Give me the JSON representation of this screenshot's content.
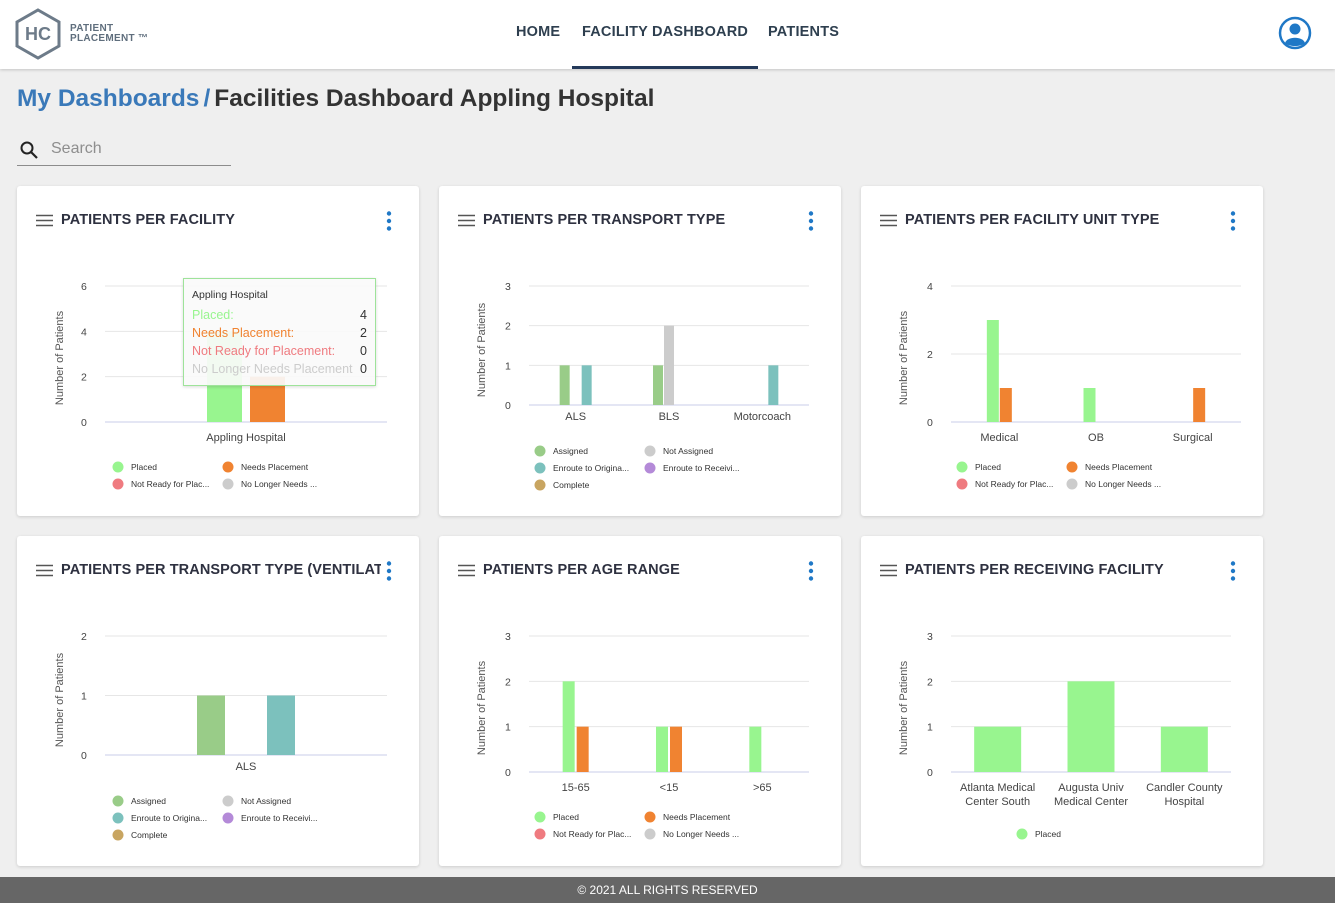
{
  "app": {
    "logo_letters": "HC",
    "logo_line1": "PATIENT",
    "logo_line2": "PLACEMENT ™"
  },
  "nav": {
    "home": "HOME",
    "facility_dashboard": "FACILITY DASHBOARD",
    "patients": "PATIENTS",
    "active": "FACILITY DASHBOARD"
  },
  "breadcrumb": {
    "parent": "My Dashboards",
    "separator": "/",
    "current": "Facilities Dashboard Appling Hospital"
  },
  "search": {
    "placeholder": "Search",
    "value": ""
  },
  "colors": {
    "placed": "#98f58f",
    "needs_placement": "#f08331",
    "not_ready": "#ef7b80",
    "no_longer": "#cccccc",
    "assigned": "#99cc88",
    "not_assigned": "#cccccc",
    "enroute_orig": "#7cc1bd",
    "enroute_recv": "#b48ad8",
    "complete": "#c8a561",
    "brand": "#3a79b9"
  },
  "cards": [
    {
      "title": "PATIENTS PER FACILITY"
    },
    {
      "title": "PATIENTS PER TRANSPORT TYPE"
    },
    {
      "title": "PATIENTS PER FACILITY UNIT TYPE"
    },
    {
      "title": "PATIENTS PER TRANSPORT TYPE (VENTILATOR)"
    },
    {
      "title": "PATIENTS PER AGE RANGE"
    },
    {
      "title": "PATIENTS PER RECEIVING FACILITY"
    }
  ],
  "tooltip": {
    "title": "Appling Hospital",
    "rows": [
      {
        "label": "Placed:",
        "value": "4",
        "color": "#98f58f"
      },
      {
        "label": "Needs Placement:",
        "value": "2",
        "color": "#f08331"
      },
      {
        "label": "Not Ready for Placement:",
        "value": "0",
        "color": "#ef7b80"
      },
      {
        "label": "No Longer Needs Placement",
        "value": "0",
        "color": "#cccccc"
      }
    ]
  },
  "chart_data": [
    {
      "type": "bar",
      "ylabel": "Number of Patients",
      "ylim": [
        0,
        6
      ],
      "yticks": [
        0,
        2,
        4,
        6
      ],
      "categories": [
        "Appling Hospital"
      ],
      "series": [
        {
          "name": "Placed",
          "color": "#98f58f",
          "values": [
            4
          ]
        },
        {
          "name": "Needs Placement",
          "color": "#f08331",
          "values": [
            2
          ]
        },
        {
          "name": "Not Ready for Plac...",
          "color": "#ef7b80",
          "values": [
            0
          ]
        },
        {
          "name": "No Longer Needs ...",
          "color": "#cccccc",
          "values": [
            0
          ]
        }
      ]
    },
    {
      "type": "bar",
      "ylabel": "Number of Patients",
      "ylim": [
        0,
        3
      ],
      "yticks": [
        0,
        1,
        2,
        3
      ],
      "categories": [
        "ALS",
        "BLS",
        "Motorcoach"
      ],
      "series": [
        {
          "name": "Assigned",
          "color": "#99cc88",
          "values": [
            1,
            1,
            0
          ]
        },
        {
          "name": "Not Assigned",
          "color": "#cccccc",
          "values": [
            0,
            2,
            0
          ]
        },
        {
          "name": "Enroute to Origina...",
          "color": "#7cc1bd",
          "values": [
            1,
            0,
            1
          ]
        },
        {
          "name": "Enroute to Receivi...",
          "color": "#b48ad8",
          "values": [
            0,
            0,
            0
          ]
        },
        {
          "name": "Complete",
          "color": "#c8a561",
          "values": [
            0,
            0,
            0
          ]
        }
      ]
    },
    {
      "type": "bar",
      "ylabel": "Number of Patients",
      "ylim": [
        0,
        4
      ],
      "yticks": [
        0,
        2,
        4
      ],
      "categories": [
        "Medical",
        "OB",
        "Surgical"
      ],
      "series": [
        {
          "name": "Placed",
          "color": "#98f58f",
          "values": [
            3,
            1,
            0
          ]
        },
        {
          "name": "Needs Placement",
          "color": "#f08331",
          "values": [
            1,
            0,
            1
          ]
        },
        {
          "name": "Not Ready for Plac...",
          "color": "#ef7b80",
          "values": [
            0,
            0,
            0
          ]
        },
        {
          "name": "No Longer Needs ...",
          "color": "#cccccc",
          "values": [
            0,
            0,
            0
          ]
        }
      ]
    },
    {
      "type": "bar",
      "ylabel": "Number of Patients",
      "ylim": [
        0,
        2
      ],
      "yticks": [
        0,
        1,
        2
      ],
      "categories": [
        "ALS"
      ],
      "series": [
        {
          "name": "Assigned",
          "color": "#99cc88",
          "values": [
            1
          ]
        },
        {
          "name": "Not Assigned",
          "color": "#cccccc",
          "values": [
            0
          ]
        },
        {
          "name": "Enroute to Origina...",
          "color": "#7cc1bd",
          "values": [
            1
          ]
        },
        {
          "name": "Enroute to Receivi...",
          "color": "#b48ad8",
          "values": [
            0
          ]
        },
        {
          "name": "Complete",
          "color": "#c8a561",
          "values": [
            0
          ]
        }
      ]
    },
    {
      "type": "bar",
      "ylabel": "Number of Patients",
      "ylim": [
        0,
        3
      ],
      "yticks": [
        0,
        1,
        2,
        3
      ],
      "categories": [
        "15-65",
        "<15",
        ">65"
      ],
      "series": [
        {
          "name": "Placed",
          "color": "#98f58f",
          "values": [
            2,
            1,
            1
          ]
        },
        {
          "name": "Needs Placement",
          "color": "#f08331",
          "values": [
            1,
            1,
            0
          ]
        },
        {
          "name": "Not Ready for Plac...",
          "color": "#ef7b80",
          "values": [
            0,
            0,
            0
          ]
        },
        {
          "name": "No Longer Needs ...",
          "color": "#cccccc",
          "values": [
            0,
            0,
            0
          ]
        }
      ]
    },
    {
      "type": "bar",
      "ylabel": "Number of Patients",
      "ylim": [
        0,
        3
      ],
      "yticks": [
        0,
        1,
        2,
        3
      ],
      "categories": [
        [
          "Atlanta Medical",
          "Center South"
        ],
        [
          "Augusta Univ",
          "Medical Center"
        ],
        [
          "Candler County",
          "Hospital"
        ]
      ],
      "series": [
        {
          "name": "Placed",
          "color": "#98f58f",
          "values": [
            1,
            2,
            1
          ]
        }
      ]
    }
  ],
  "footer": {
    "text": "© 2021 ALL RIGHTS RESERVED"
  }
}
